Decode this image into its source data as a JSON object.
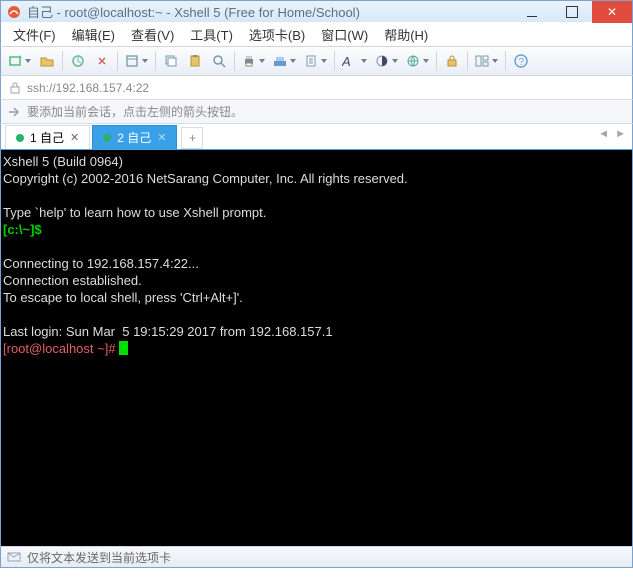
{
  "window": {
    "title": "自己 - root@localhost:~ - Xshell 5 (Free for Home/School)"
  },
  "menu": {
    "file": "文件(F)",
    "edit": "编辑(E)",
    "view": "查看(V)",
    "tools": "工具(T)",
    "tabs": "选项卡(B)",
    "window": "窗口(W)",
    "help": "帮助(H)"
  },
  "address": {
    "value": "ssh://192.168.157.4:22"
  },
  "hint": {
    "text": "要添加当前会话，点击左侧的箭头按钮。"
  },
  "tabs": {
    "items": [
      {
        "label": "1 自己",
        "active": false
      },
      {
        "label": "2 自己",
        "active": true
      }
    ]
  },
  "terminal": {
    "line1": "Xshell 5 (Build 0964)",
    "line2": "Copyright (c) 2002-2016 NetSarang Computer, Inc. All rights reserved.",
    "line3": "",
    "line4": "Type `help' to learn how to use Xshell prompt.",
    "prompt_local": "[c:\\~]$",
    "line6": "",
    "line7": "Connecting to 192.168.157.4:22...",
    "line8": "Connection established.",
    "line9": "To escape to local shell, press 'Ctrl+Alt+]'.",
    "line10": "",
    "line11": "Last login: Sun Mar  5 19:15:29 2017 from 192.168.157.1",
    "prompt_remote": "[root@localhost ~]# "
  },
  "status": {
    "text": "仅将文本发送到当前选项卡"
  }
}
